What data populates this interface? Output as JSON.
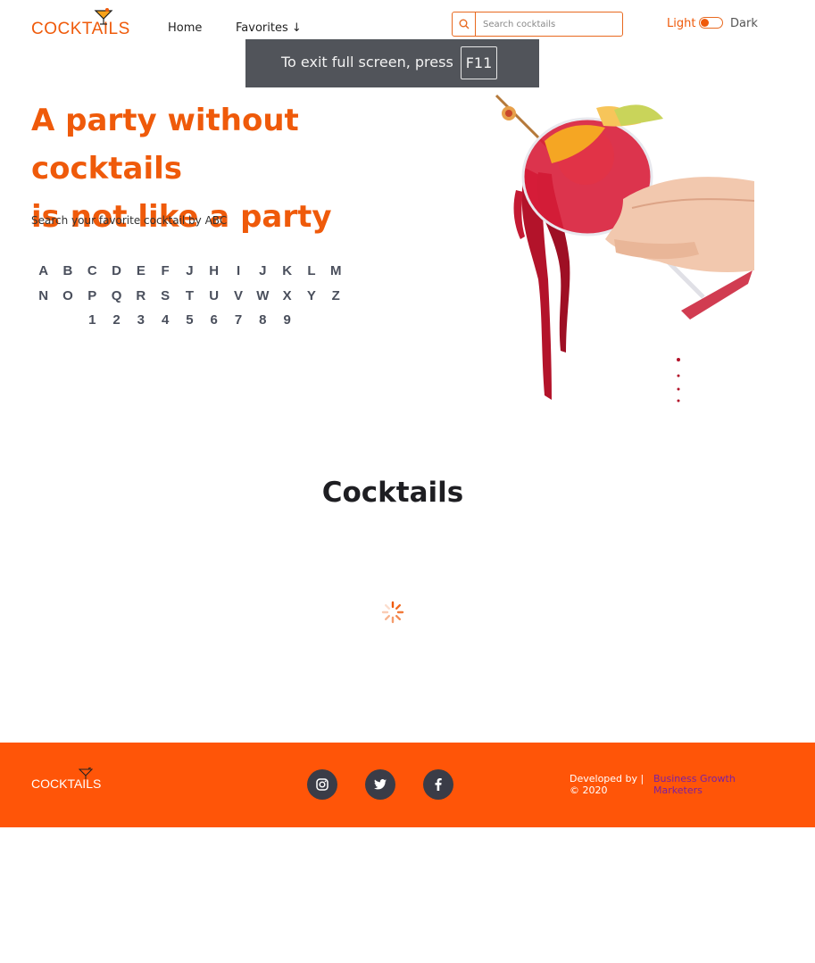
{
  "header": {
    "logo_text": "COCKTAILS",
    "nav": {
      "home": "Home",
      "favorites": "Favorites ↓"
    },
    "search": {
      "placeholder": "Search cocktails",
      "icon": "search-icon"
    },
    "theme": {
      "light_label": "Light",
      "dark_label": "Dark",
      "current": "light"
    }
  },
  "fullscreen_notice": {
    "text": "To exit full screen, press",
    "key": "F11"
  },
  "hero": {
    "title_line1": "A party without cocktails",
    "title_line2": "is not like a party",
    "subtitle": "Search your favorite cocktail by ABC",
    "letters_row1": [
      "A",
      "B",
      "C",
      "D",
      "E",
      "F",
      "J",
      "H",
      "I",
      "J",
      "K",
      "L",
      "M"
    ],
    "letters_row2": [
      "N",
      "O",
      "P",
      "Q",
      "R",
      "S",
      "T",
      "U",
      "V",
      "W",
      "X",
      "Y",
      "Z"
    ],
    "numbers_row": [
      "1",
      "2",
      "3",
      "4",
      "5",
      "6",
      "7",
      "8",
      "9"
    ]
  },
  "section": {
    "title": "Cocktails",
    "loading": true
  },
  "footer": {
    "logo_text": "COCKTAILS",
    "social": [
      "instagram-icon",
      "twitter-icon",
      "facebook-icon"
    ],
    "developed_by": "Developed by |",
    "year": "© 2020",
    "developer_name": "Business Growth Marketers"
  },
  "colors": {
    "accent": "#ef5a0a",
    "footer_bg": "#ff5508",
    "social_bg": "#3a3c47",
    "toast_bg": "#51545a",
    "dev_link": "#7a1fa3"
  }
}
